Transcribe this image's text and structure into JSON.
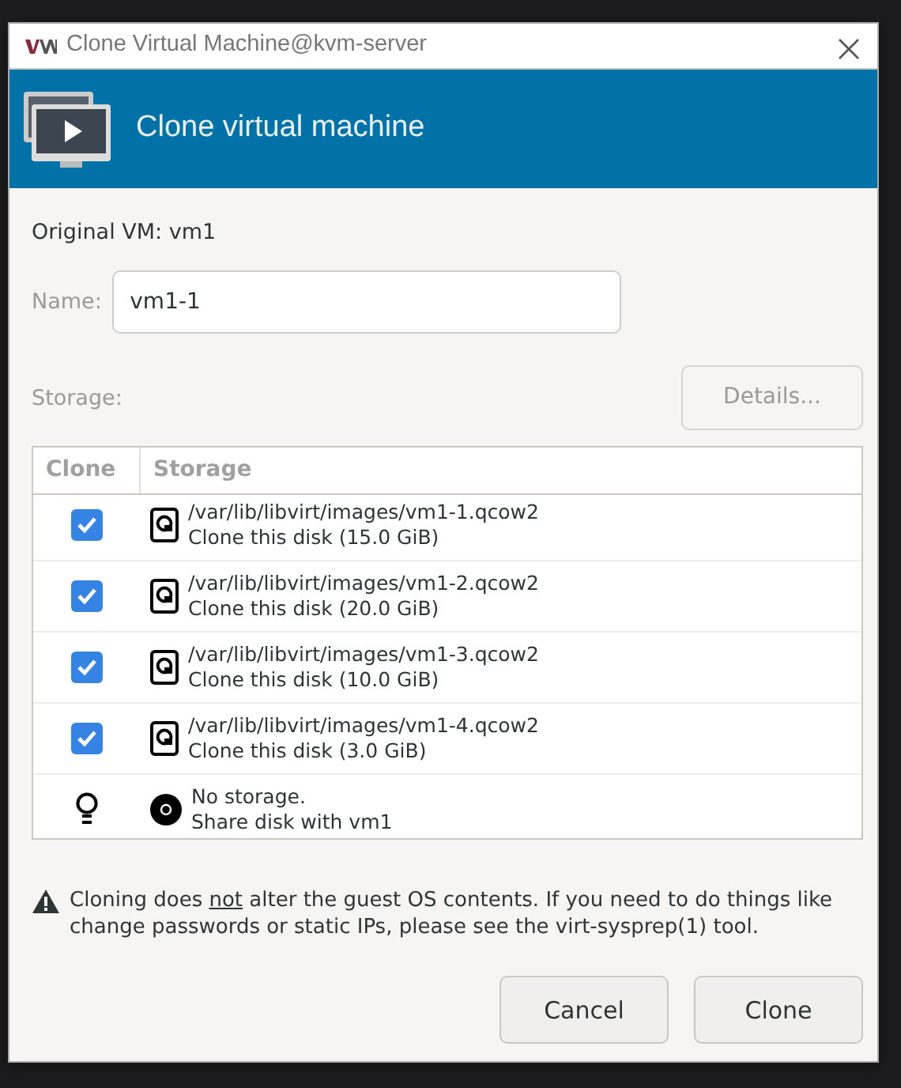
{
  "window": {
    "title": "Clone Virtual Machine@kvm-server"
  },
  "header": {
    "title": "Clone virtual machine"
  },
  "original_vm": "Original VM: vm1",
  "name_field": {
    "label": "Name:",
    "value": "vm1-1"
  },
  "storage": {
    "label": "Storage:",
    "details_button": {
      "label": "Details...",
      "disabled": true
    }
  },
  "table": {
    "columns": [
      "Clone",
      "Storage"
    ],
    "rows": [
      {
        "kind": "disk",
        "checked": true,
        "path": "/var/lib/libvirt/images/vm1-1.qcow2",
        "action": "Clone this disk (15.0 GiB)"
      },
      {
        "kind": "disk",
        "checked": true,
        "path": "/var/lib/libvirt/images/vm1-2.qcow2",
        "action": "Clone this disk (20.0 GiB)"
      },
      {
        "kind": "disk",
        "checked": true,
        "path": "/var/lib/libvirt/images/vm1-3.qcow2",
        "action": "Clone this disk (10.0 GiB)"
      },
      {
        "kind": "disk",
        "checked": true,
        "path": "/var/lib/libvirt/images/vm1-4.qcow2",
        "action": "Clone this disk (3.0 GiB)"
      },
      {
        "kind": "cdrom",
        "path": "No storage.",
        "action": "Share disk with vm1"
      }
    ]
  },
  "warning": "Cloning does *not* alter the guest OS contents. If you need to do things like change passwords or static IPs, please see the virt-sysprep(1) tool.",
  "buttons": [
    "Cancel",
    "Clone"
  ]
}
